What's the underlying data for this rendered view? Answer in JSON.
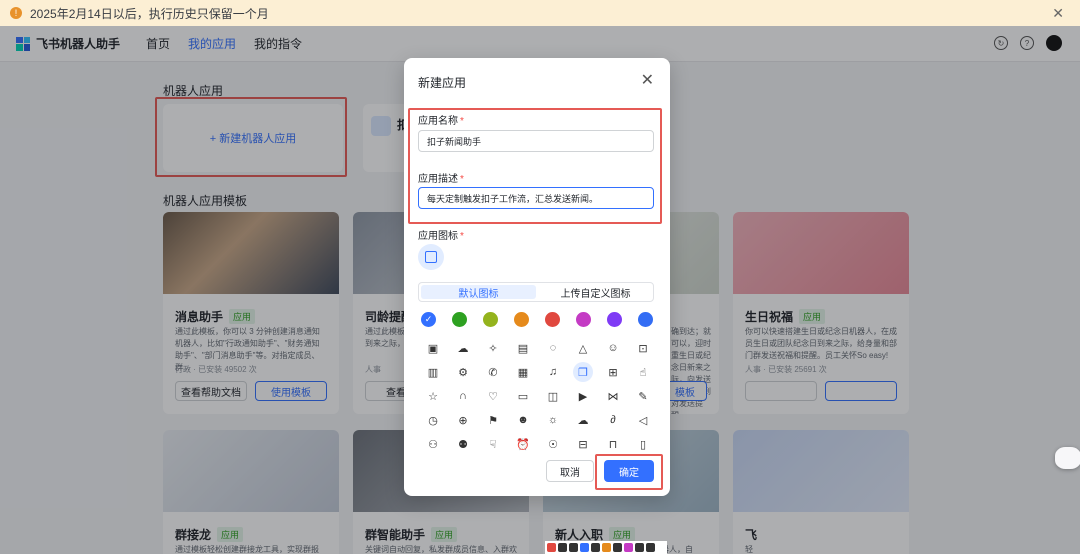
{
  "banner": {
    "text": "2025年2月14日以后，执行历史只保留一个月"
  },
  "topbar": {
    "brand": "飞书机器人助手",
    "nav": [
      "首页",
      "我的应用",
      "我的指令"
    ]
  },
  "main": {
    "section_robot_apps": "机器人应用",
    "new_app_label": "+ 新建机器人应用",
    "app_card_partial_title": "扣",
    "section_templates": "机器人应用模板",
    "templates": [
      {
        "title": "消息助手",
        "tag": "应用",
        "desc": "通过此模板，你可以 3 分钟创建消息通知机器人，比如\"行政通知助手\"、\"财务通知助手\"、\"部门消息助手\"等。对指定成员、群...",
        "meta": "行政 · 已安装 49502 次",
        "btn_doc": "查看帮助文档",
        "btn_use": "使用模板"
      },
      {
        "title": "司龄提醒",
        "desc": "通过此模板，可让机器人，帮助你及时的日到来之际，给",
        "meta": "人事",
        "btn_doc": "查看帮"
      },
      {
        "title": "生日祝福",
        "tag": "应用",
        "desc": "你可以快速搭建生日或纪念日机器人，在成员生日或团队纪念日到来之际，给身量和部门群发送祝福和提醒。员工关怀So easy!",
        "meta": "人事 · 已安装 25691 次"
      },
      {
        "title": "群接龙",
        "tag": "应用",
        "desc": "通过模板轻松创建群接龙工具，实现群报名..."
      },
      {
        "title": "群智能助手",
        "tag": "应用",
        "desc": "关键词自动回复，私发群成员信息、入群欢迎"
      },
      {
        "title": "新人入职",
        "tag": "应用",
        "desc": "机器人，自"
      },
      {
        "title": "飞",
        "desc": "轻"
      }
    ],
    "partial_right_desc": "确到达；就可以，迎时重生日或纪念日新来之际，向发送祝福，直到对发送提醒。",
    "partial_btn": "模板"
  },
  "modal": {
    "title": "新建应用",
    "close_icon": "close-icon",
    "name_label": "应用名称",
    "name_value": "扣子新闻助手",
    "desc_label": "应用描述",
    "desc_value": "每天定制触发扣子工作流，汇总发送新闻。",
    "icon_label": "应用图标",
    "required_mark": "*",
    "tabs": [
      "默认图标",
      "上传自定义图标"
    ],
    "active_tab": "默认图标",
    "colors": [
      "#3370ff",
      "#2ea121",
      "#94b31d",
      "#e58a1c",
      "#e0483f",
      "#c43bc4",
      "#7f3bf5",
      "#336df4"
    ],
    "selected_color": "#3370ff",
    "cancel": "取消",
    "confirm": "确定"
  }
}
